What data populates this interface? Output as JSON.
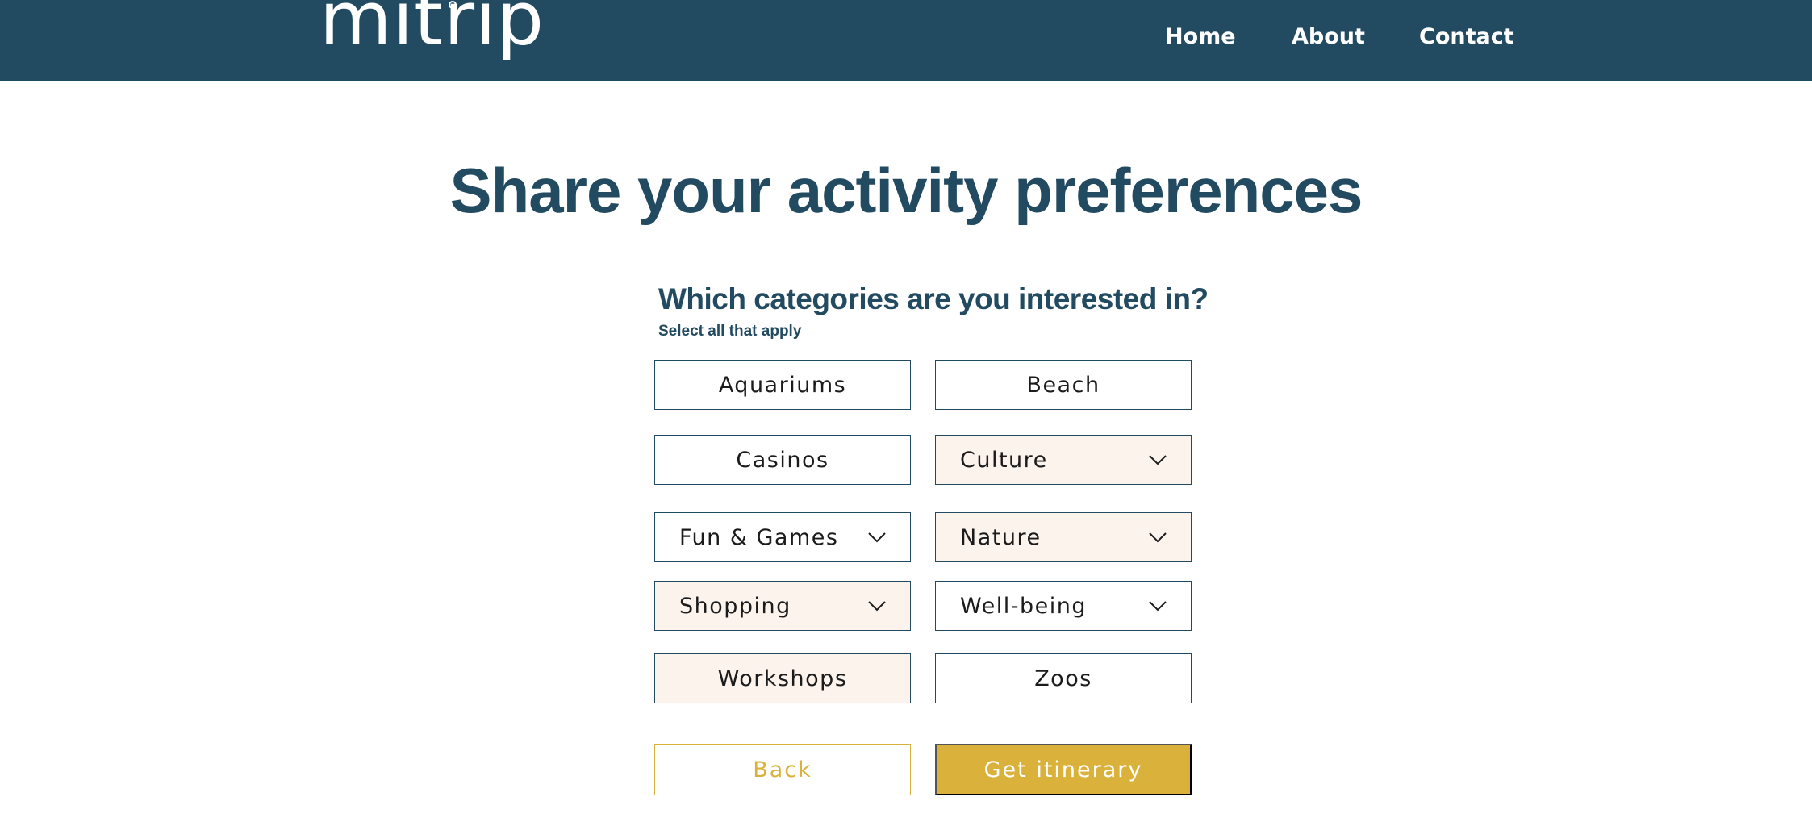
{
  "header": {
    "logo_text": "mitrip",
    "nav": {
      "home": "Home",
      "about": "About",
      "contact": "Contact"
    }
  },
  "main": {
    "title": "Share your activity preferences",
    "question": "Which categories are you interested in?",
    "hint": "Select all that apply",
    "options": {
      "aquariums": "Aquariums",
      "beach": "Beach",
      "casinos": "Casinos",
      "culture": "Culture",
      "fun_games": "Fun & Games",
      "nature": "Nature",
      "shopping": "Shopping",
      "well_being": "Well-being",
      "workshops": "Workshops",
      "zoos": "Zoos"
    },
    "selected": [
      "Culture",
      "Nature",
      "Shopping",
      "Workshops"
    ],
    "buttons": {
      "back": "Back",
      "get_itinerary": "Get itinerary"
    }
  },
  "colors": {
    "header_bg": "#224a60",
    "heading": "#224a60",
    "selected_bg": "#fcf3ed",
    "accent": "#dab23b"
  },
  "icons": {
    "dropdown": "chevron-down-icon"
  }
}
